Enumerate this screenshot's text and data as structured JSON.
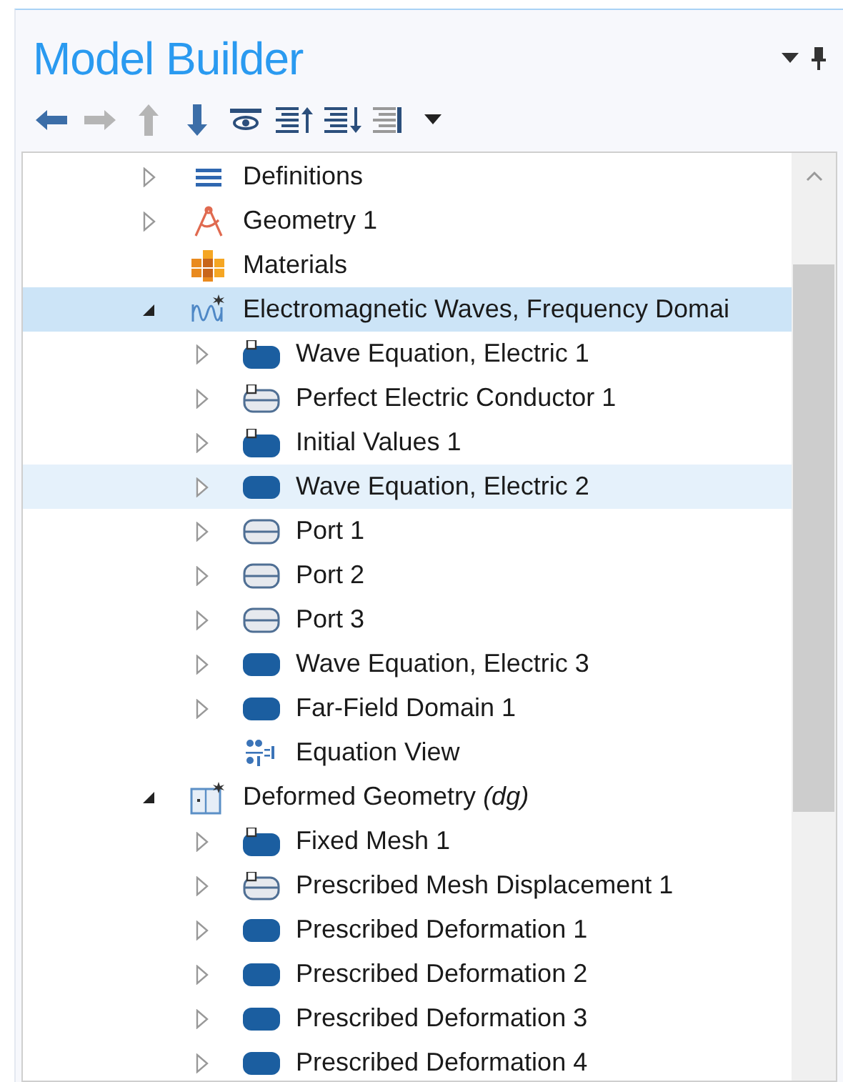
{
  "panel": {
    "title": "Model Builder"
  },
  "toolbar": [
    {
      "kind": "back",
      "disabled": false
    },
    {
      "kind": "forward",
      "disabled": true
    },
    {
      "kind": "up",
      "disabled": true
    },
    {
      "kind": "down",
      "disabled": false
    },
    {
      "kind": "eye",
      "disabled": false
    },
    {
      "kind": "list-up",
      "disabled": false
    },
    {
      "kind": "list-down",
      "disabled": false
    },
    {
      "kind": "list",
      "disabled": false
    },
    {
      "kind": "caret",
      "disabled": false
    }
  ],
  "tree": [
    {
      "label": "Definitions",
      "kind": "definitions",
      "expanded": false,
      "selected": false,
      "hovered": false
    },
    {
      "label": "Geometry 1",
      "kind": "geometry",
      "expanded": false,
      "selected": false,
      "hovered": false
    },
    {
      "label": "Materials",
      "kind": "materials",
      "selected": false,
      "hovered": false
    },
    {
      "label": "Electromagnetic Waves, Frequency Domai",
      "kind": "physics",
      "expanded": true,
      "selected": true,
      "hovered": false,
      "children": [
        {
          "label": "Wave Equation, Electric 1",
          "kind": "domain-default",
          "expanded": false,
          "selected": false,
          "hovered": false
        },
        {
          "label": "Perfect Electric Conductor 1",
          "kind": "boundary-default",
          "expanded": false,
          "selected": false,
          "hovered": false
        },
        {
          "label": "Initial Values 1",
          "kind": "domain-default",
          "expanded": false,
          "selected": false,
          "hovered": false
        },
        {
          "label": "Wave Equation, Electric 2",
          "kind": "domain",
          "expanded": false,
          "selected": false,
          "hovered": true
        },
        {
          "label": "Port 1",
          "kind": "boundary",
          "expanded": false,
          "selected": false,
          "hovered": false
        },
        {
          "label": "Port 2",
          "kind": "boundary",
          "expanded": false,
          "selected": false,
          "hovered": false
        },
        {
          "label": "Port 3",
          "kind": "boundary",
          "expanded": false,
          "selected": false,
          "hovered": false
        },
        {
          "label": "Wave Equation, Electric 3",
          "kind": "domain",
          "expanded": false,
          "selected": false,
          "hovered": false
        },
        {
          "label": "Far-Field Domain 1",
          "kind": "domain",
          "expanded": false,
          "selected": false,
          "hovered": false
        },
        {
          "label": "Equation View",
          "kind": "equation",
          "selected": false,
          "hovered": false
        }
      ]
    },
    {
      "label": "Deformed Geometry *(dg)*",
      "kind": "deformed",
      "expanded": true,
      "selected": false,
      "hovered": false,
      "children": [
        {
          "label": "Fixed Mesh 1",
          "kind": "domain-default",
          "expanded": false,
          "selected": false,
          "hovered": false
        },
        {
          "label": "Prescribed Mesh Displacement 1",
          "kind": "boundary-default",
          "expanded": false,
          "selected": false,
          "hovered": false
        },
        {
          "label": "Prescribed Deformation 1",
          "kind": "domain",
          "expanded": false,
          "selected": false,
          "hovered": false
        },
        {
          "label": "Prescribed Deformation 2",
          "kind": "domain",
          "expanded": false,
          "selected": false,
          "hovered": false
        },
        {
          "label": "Prescribed Deformation 3",
          "kind": "domain",
          "expanded": false,
          "selected": false,
          "hovered": false
        },
        {
          "label": "Prescribed Deformation 4",
          "kind": "domain",
          "expanded": false,
          "selected": false,
          "hovered": false
        }
      ]
    }
  ]
}
